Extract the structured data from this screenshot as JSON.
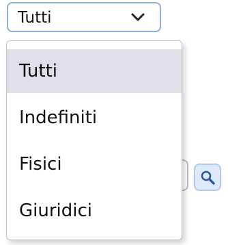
{
  "select": {
    "value": "Tutti",
    "options": [
      "Tutti",
      "Indefiniti",
      "Fisici",
      "Giuridici"
    ]
  },
  "search_button": {
    "icon": "search-icon"
  },
  "colors": {
    "select_border": "#8fb0d9",
    "selected_option_bg": "#dfe0e7",
    "search_button_bg": "#ddeafa",
    "search_icon": "#2a5a9a"
  }
}
